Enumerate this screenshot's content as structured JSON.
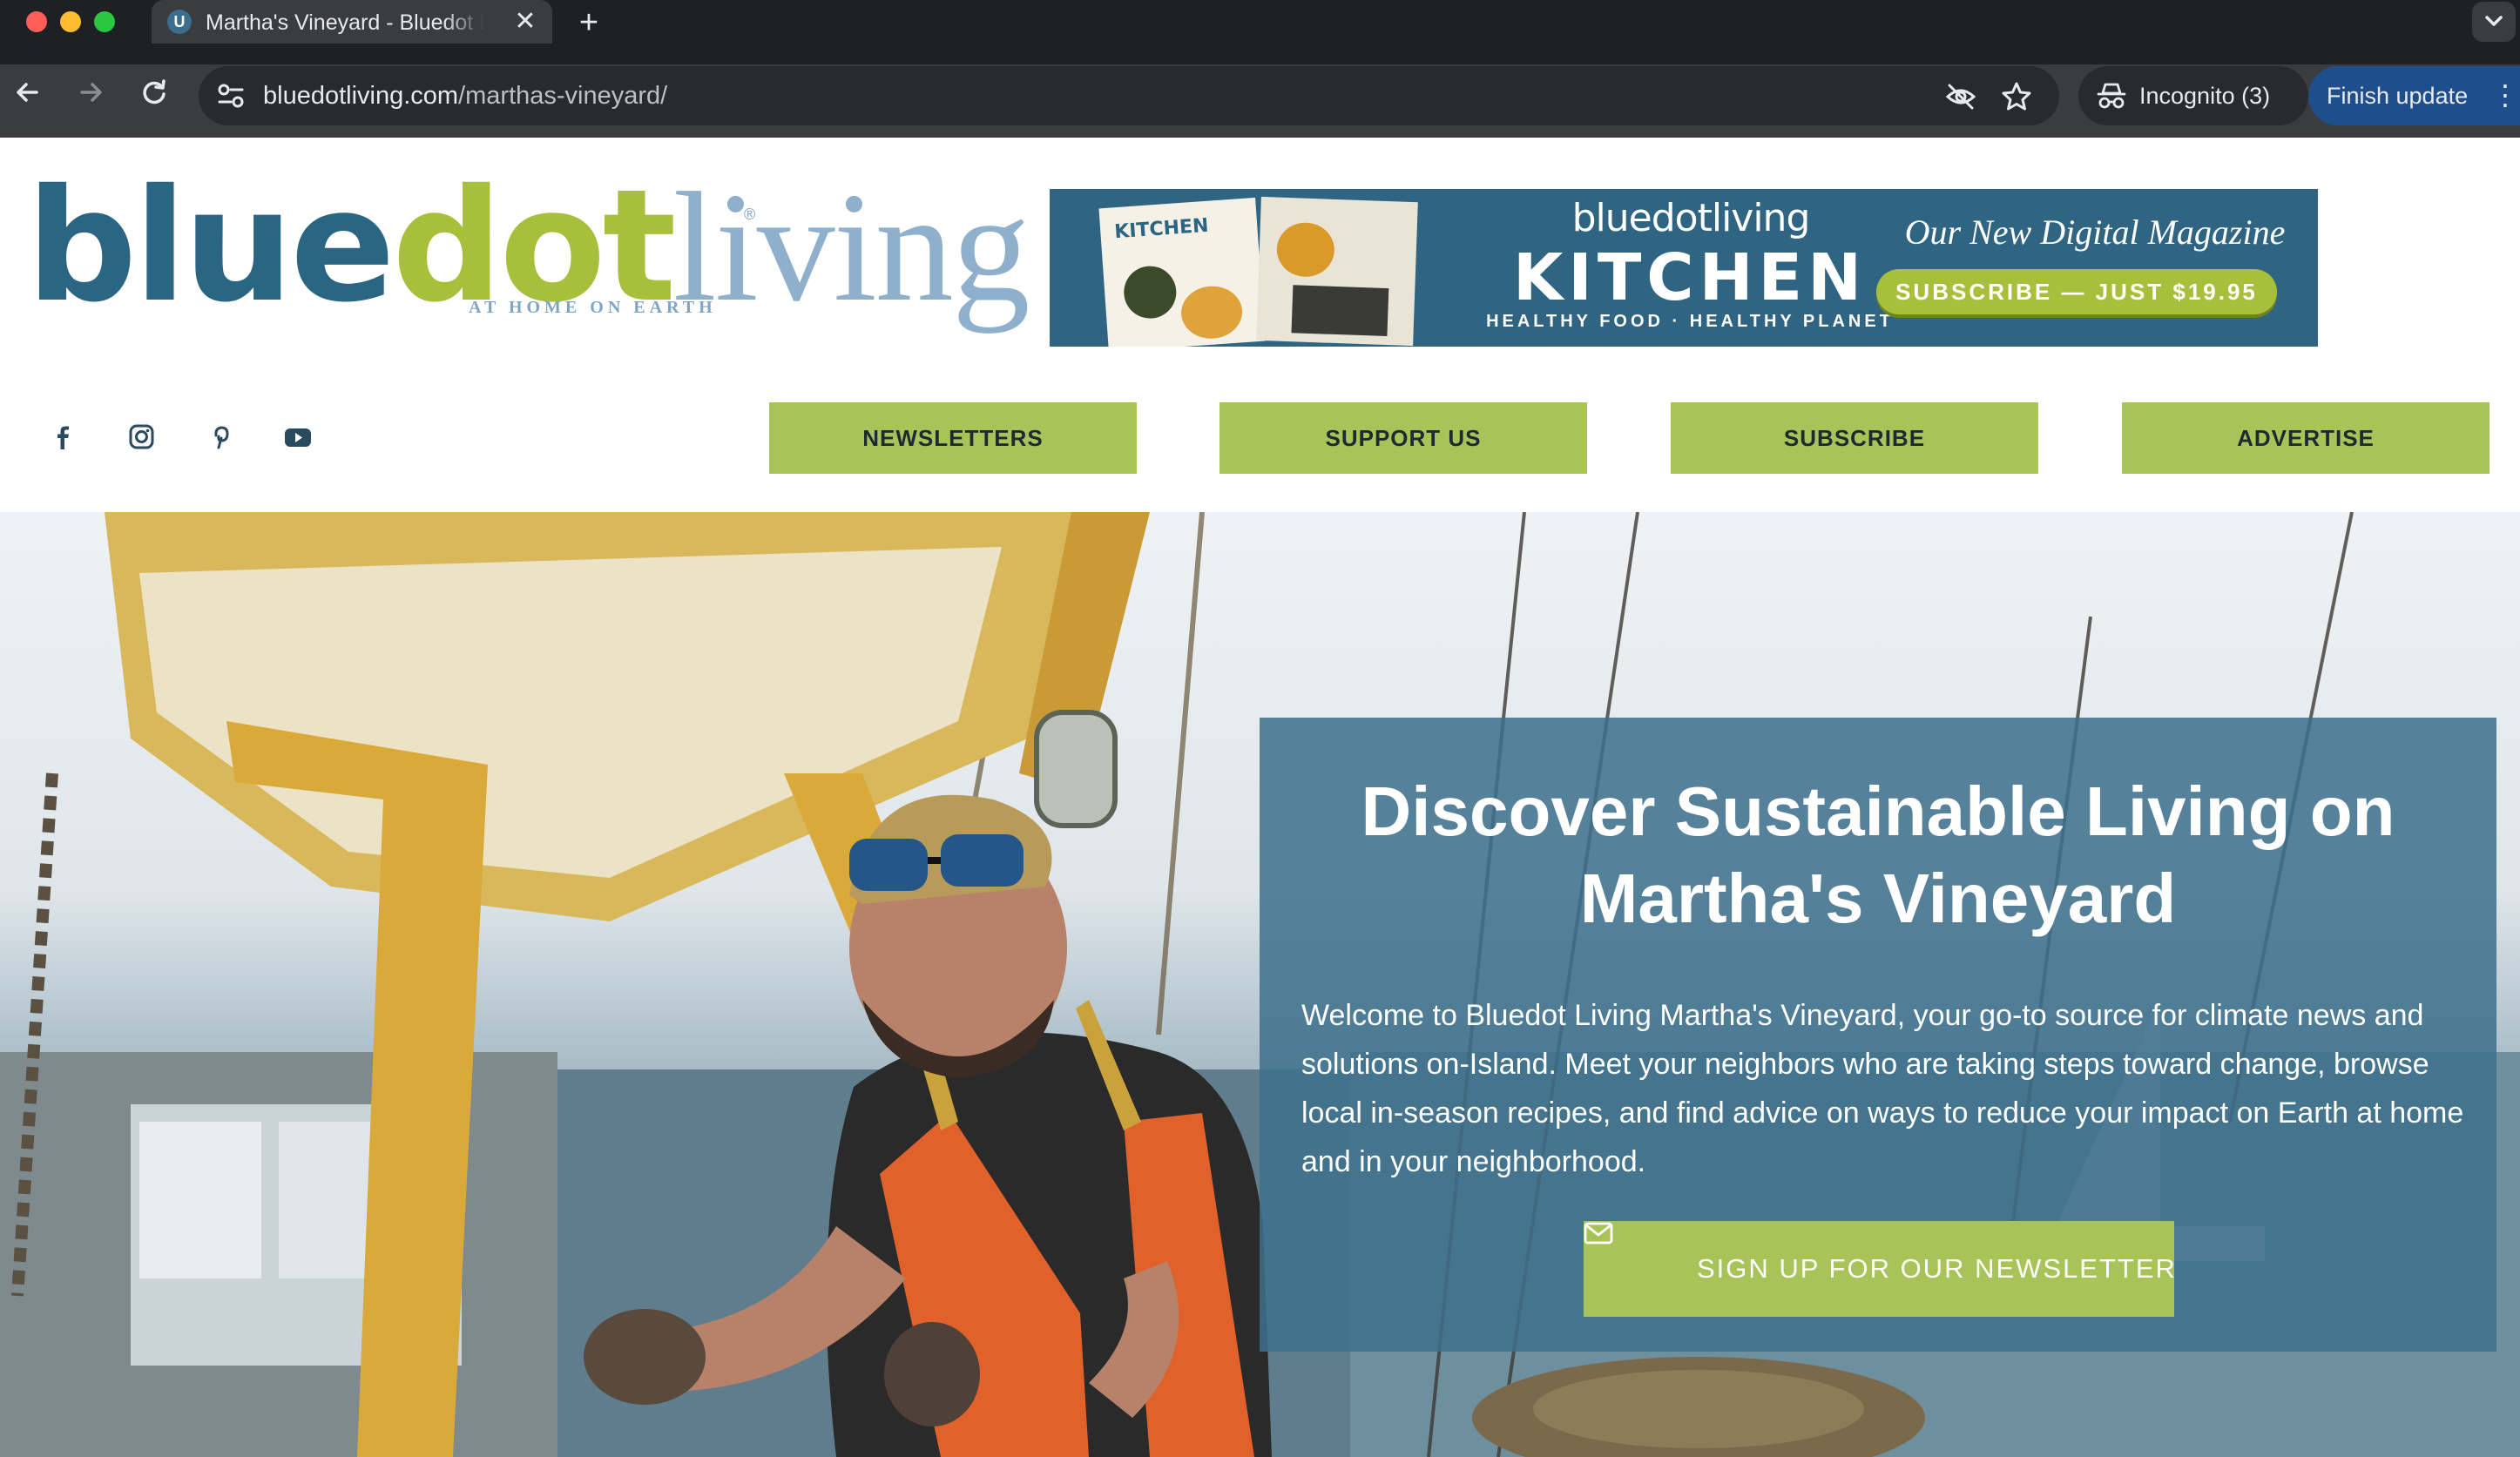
{
  "browser": {
    "tab_title": "Martha's Vineyard - Bluedot Living",
    "tab_favicon": "U",
    "tab_close_glyph": "✕",
    "new_tab_glyph": "+",
    "url_domain": "bluedotliving.com",
    "url_path": "/marthas-vineyard/",
    "incognito_label": "Incognito (3)",
    "update_label": "Finish update",
    "update_menu_glyph": "⋮"
  },
  "logo": {
    "part_blue": "blue",
    "part_green": "dot",
    "part_light": "living",
    "tagline": "AT HOME ON EARTH",
    "registered": "®"
  },
  "banner": {
    "magazine_cover_title": "KITCHEN",
    "brand": "bluedotliving",
    "title": "KITCHEN",
    "subtitle": "HEALTHY FOOD · HEALTHY PLANET",
    "tagline": "Our New Digital Magazine",
    "cta": "SUBSCRIBE — JUST $19.95"
  },
  "social": [
    "facebook-icon",
    "instagram-icon",
    "pinterest-icon",
    "youtube-icon"
  ],
  "nav": {
    "items": [
      {
        "label": "NEWSLETTERS"
      },
      {
        "label": "SUPPORT US"
      },
      {
        "label": "SUBSCRIBE"
      },
      {
        "label": "ADVERTISE"
      }
    ]
  },
  "hero": {
    "title": "Discover Sustainable Living on Martha's Vineyard",
    "body": "Welcome to Bluedot Living Martha's Vineyard, your go-to source for climate news and solutions on-Island. Meet your neighbors who are taking steps toward change, browse local in-season recipes, and find advice on ways to reduce your impact on Earth at home and in your neighborhood.",
    "cta": "SIGN UP FOR OUR NEWSLETTER"
  },
  "colors": {
    "brand_blue": "#2a6683",
    "brand_green": "#a8bf3c",
    "nav_green": "#a8c458",
    "overlay_blue": "#3e708c"
  }
}
